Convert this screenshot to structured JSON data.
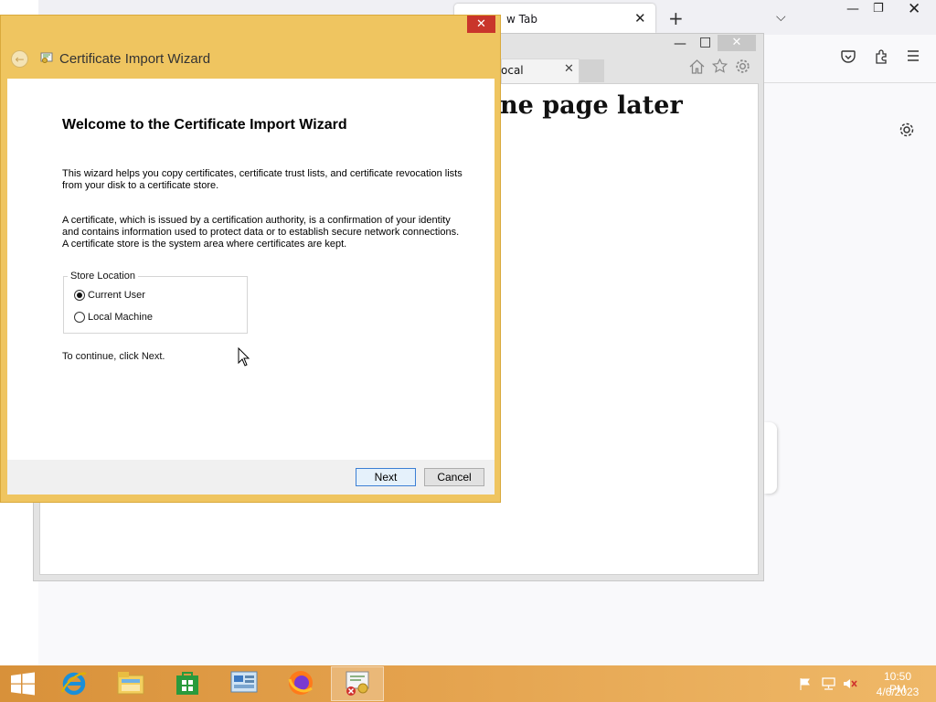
{
  "firefox": {
    "tab_title": "New Tab",
    "tab_title_visible": "w Tab",
    "tab_close": "✕",
    "new_tab": "+",
    "list_tabs": "⌵",
    "min": "—",
    "restore": "❐",
    "close": "✕",
    "icons": [
      "pocket-icon",
      "extensions-icon",
      "menu-icon",
      "settings-gear-icon"
    ]
  },
  "ie": {
    "tab_label": "ocal",
    "tab_close": "✕",
    "min": "—",
    "max": "□",
    "close": "✕",
    "page_text": "ne page later",
    "icons": [
      "home-icon",
      "favorites-star-icon",
      "tools-gear-icon"
    ]
  },
  "wizard": {
    "title": "Certificate Import Wizard",
    "close": "✕",
    "back": "←",
    "heading": "Welcome to the Certificate Import Wizard",
    "para1": "This wizard helps you copy certificates, certificate trust lists, and certificate revocation lists from your disk to a certificate store.",
    "para2": "A certificate, which is issued by a certification authority, is a confirmation of your identity and contains information used to protect data or to establish secure network connections. A certificate store is the system area where certificates are kept.",
    "store_location": {
      "legend": "Store Location",
      "options": [
        {
          "label": "Current User",
          "selected": true
        },
        {
          "label": "Local Machine",
          "selected": false
        }
      ]
    },
    "continue_text": "To continue, click Next.",
    "next_label": "Next",
    "cancel_label": "Cancel"
  },
  "taskbar": {
    "apps": [
      {
        "name": "Internet Explorer",
        "icon": "internet-explorer-icon"
      },
      {
        "name": "File Explorer",
        "icon": "file-explorer-icon"
      },
      {
        "name": "Store",
        "icon": "store-icon"
      },
      {
        "name": "Control Panel",
        "icon": "control-panel-icon"
      },
      {
        "name": "Firefox",
        "icon": "firefox-icon"
      },
      {
        "name": "Certificate",
        "icon": "certificate-icon",
        "active": true
      }
    ],
    "clock_time": "10:50 PM",
    "clock_date": "4/6/2023"
  },
  "colors": {
    "wizard_frame": "#efc560",
    "taskbar": "#e3a04b",
    "close_red": "#c9352b"
  }
}
